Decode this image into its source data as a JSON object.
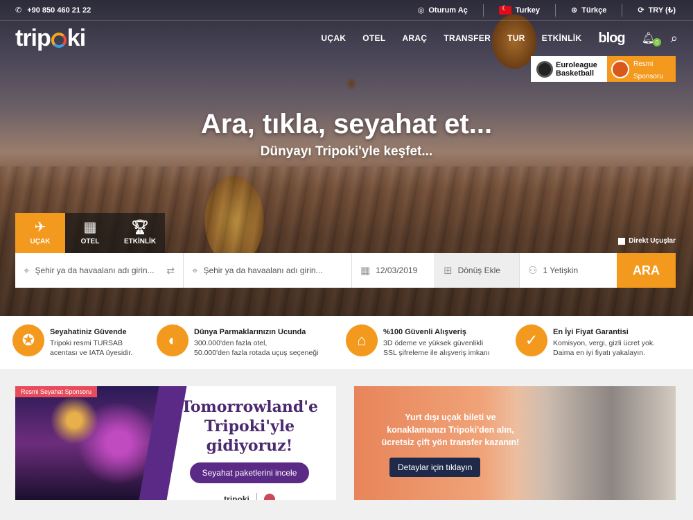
{
  "topbar": {
    "phone": "+90 850 460 21 22",
    "login": "Oturum Aç",
    "country": "Turkey",
    "language": "Türkçe",
    "currency": "TRY (₺)"
  },
  "logo": {
    "text_a": "trip",
    "text_b": "ki"
  },
  "nav": {
    "items": [
      "UÇAK",
      "OTEL",
      "ARAÇ",
      "TRANSFER",
      "TUR",
      "ETKİNLİK"
    ],
    "blog": "blog",
    "notifications_count": "0"
  },
  "sponsor": {
    "left_line1": "Euroleague",
    "left_line2": "Basketball",
    "right_line1": "Resmi",
    "right_line2": "Sponsoru"
  },
  "hero": {
    "headline": "Ara, tıkla, seyahat et...",
    "subline": "Dünyayı Tripoki'yle keşfet..."
  },
  "tabs": [
    {
      "label": "UÇAK",
      "icon": "plane-icon",
      "active": true
    },
    {
      "label": "OTEL",
      "icon": "hotel-icon",
      "active": false
    },
    {
      "label": "ETKİNLİK",
      "icon": "trophy-icon",
      "active": false
    }
  ],
  "direct_flights": "Direkt Uçuşlar",
  "search": {
    "from_placeholder": "Şehir ya da havaalanı adı girin...",
    "to_placeholder": "Şehir ya da havaalanı adı girin...",
    "date": "12/03/2019",
    "return": "Dönüş Ekle",
    "passengers": "1 Yetişkin",
    "submit": "ARA"
  },
  "features": [
    {
      "title": "Seyahatiniz Güvende",
      "line1": "Tripoki resmi TURSAB",
      "line2": "acentası ve IATA üyesidir.",
      "icon": "medal-icon"
    },
    {
      "title": "Dünya Parmaklarınızın Ucunda",
      "line1": "300.000'den fazla otel,",
      "line2": "50.000'den fazla rotada uçuş seçeneği",
      "icon": "globe-hand-icon"
    },
    {
      "title": "%100 Güvenli Alışveriş",
      "line1": "3D ödeme ve yüksek güvenlikli",
      "line2": "SSL şifreleme ile alışveriş imkanı",
      "icon": "ssl-lock-icon"
    },
    {
      "title": "En İyi Fiyat Garantisi",
      "line1": "Komisyon, vergi, gizli ücret yok.",
      "line2": "Daima en iyi fiyatı yakalayın.",
      "icon": "checkmark-icon"
    }
  ],
  "banner1": {
    "tag": "Resmi Seyahat Sponsoru",
    "title_line1": "Tomorrowland'e",
    "title_line2": "Tripoki'yle gidiyoruz!",
    "button": "Seyahat paketlerini incele",
    "footer_logo": "tripoki"
  },
  "banner2": {
    "line1": "Yurt dışı uçak bileti ve",
    "line2": "konaklamanızı Tripoki'den alın,",
    "line3": "ücretsiz çift yön transfer kazanın!",
    "button": "Detaylar için tıklayın"
  },
  "colors": {
    "accent": "#f39a1e",
    "purple": "#5b2a86",
    "navy": "#1f2a4a"
  }
}
